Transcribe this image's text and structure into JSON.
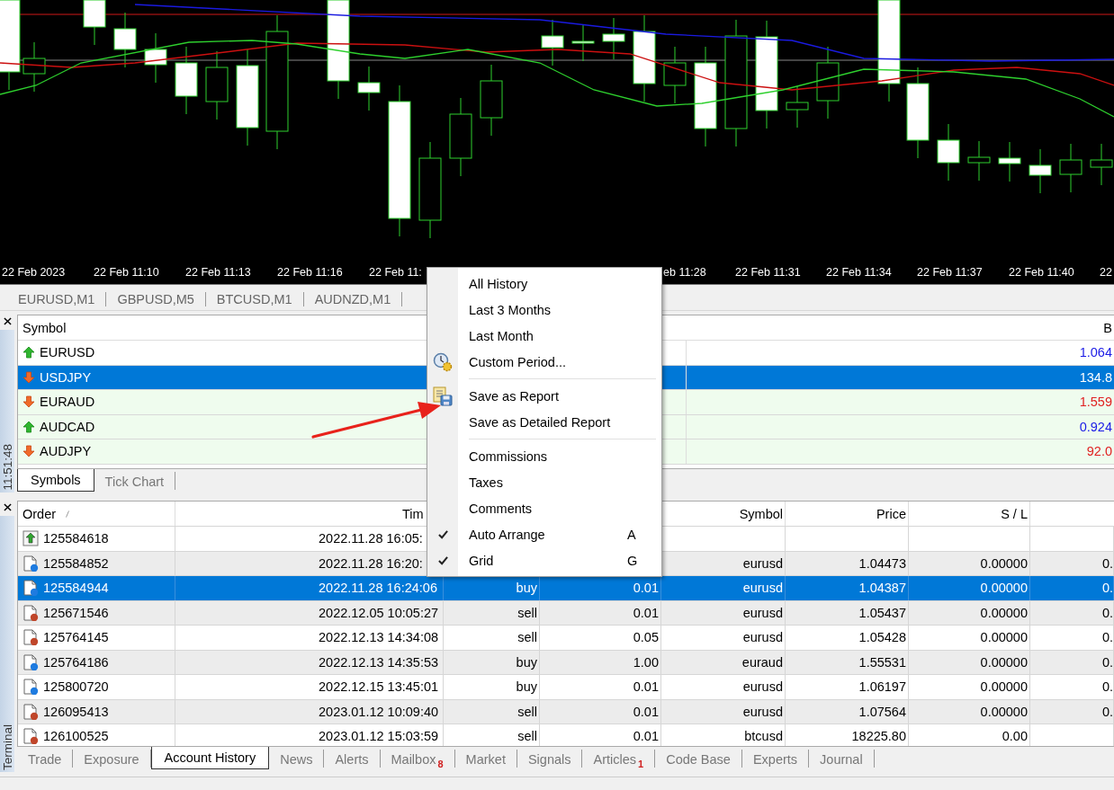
{
  "chart": {
    "time_axis": [
      "22 Feb 2023",
      "22 Feb 11:10",
      "22 Feb 11:13",
      "22 Feb 11:16",
      "22 Feb 11:",
      "eb 11:28",
      "22 Feb 11:31",
      "22 Feb 11:34",
      "22 Feb 11:37",
      "22 Feb 11:40",
      "22"
    ]
  },
  "chart_tabs": [
    "EURUSD,M1",
    "GBPUSD,M5",
    "BTCUSD,M1",
    "AUDNZD,M1"
  ],
  "market_watch": {
    "clock": "11:51:48",
    "columns": [
      "Symbol",
      "B"
    ],
    "rows": [
      {
        "symbol": "EURUSD",
        "rising": true,
        "highlighted": false,
        "selected": false,
        "bid": "1.064"
      },
      {
        "symbol": "USDJPY",
        "rising": false,
        "highlighted": true,
        "selected": true,
        "bid": "134.8"
      },
      {
        "symbol": "EURAUD",
        "rising": false,
        "highlighted": true,
        "selected": false,
        "bid": "1.559"
      },
      {
        "symbol": "AUDCAD",
        "rising": true,
        "highlighted": true,
        "selected": false,
        "bid": "0.924"
      },
      {
        "symbol": "AUDJPY",
        "rising": false,
        "highlighted": true,
        "selected": false,
        "bid": "92.0"
      }
    ],
    "tabs": [
      {
        "label": "Symbols",
        "selected": true
      },
      {
        "label": "Tick Chart",
        "selected": false
      }
    ]
  },
  "terminal": {
    "label": "Terminal",
    "columns": [
      "Order",
      "Tim",
      "Symbol",
      "Price",
      "S / L"
    ],
    "rows": [
      {
        "kind": "deposit",
        "selected": false,
        "order": "125584618",
        "time": "2022.11.28 16:05:"
      },
      {
        "kind": "buy",
        "selected": false,
        "order": "125584852",
        "time": "2022.11.28 16:20:",
        "symbol": "eurusd",
        "price": "1.04473",
        "sl": "0.00000",
        "tp": "0."
      },
      {
        "kind": "buy",
        "selected": true,
        "order": "125584944",
        "time": "2022.11.28 16:24:06",
        "type": "buy",
        "volume": "0.01",
        "symbol": "eurusd",
        "price": "1.04387",
        "sl": "0.00000",
        "tp": "0."
      },
      {
        "kind": "sell",
        "selected": false,
        "order": "125671546",
        "time": "2022.12.05 10:05:27",
        "type": "sell",
        "volume": "0.01",
        "symbol": "eurusd",
        "price": "1.05437",
        "sl": "0.00000",
        "tp": "0."
      },
      {
        "kind": "sell",
        "selected": false,
        "order": "125764145",
        "time": "2022.12.13 14:34:08",
        "type": "sell",
        "volume": "0.05",
        "symbol": "eurusd",
        "price": "1.05428",
        "sl": "0.00000",
        "tp": "0."
      },
      {
        "kind": "buy",
        "selected": false,
        "order": "125764186",
        "time": "2022.12.13 14:35:53",
        "type": "buy",
        "volume": "1.00",
        "symbol": "euraud",
        "price": "1.55531",
        "sl": "0.00000",
        "tp": "0."
      },
      {
        "kind": "buy",
        "selected": false,
        "order": "125800720",
        "time": "2022.12.15 13:45:01",
        "type": "buy",
        "volume": "0.01",
        "symbol": "eurusd",
        "price": "1.06197",
        "sl": "0.00000",
        "tp": "0."
      },
      {
        "kind": "sell",
        "selected": false,
        "order": "126095413",
        "time": "2023.01.12 10:09:40",
        "type": "sell",
        "volume": "0.01",
        "symbol": "eurusd",
        "price": "1.07564",
        "sl": "0.00000",
        "tp": "0."
      },
      {
        "kind": "sell",
        "selected": false,
        "order": "126100525",
        "time": "2023.01.12 15:03:59",
        "type": "sell",
        "volume": "0.01",
        "symbol": "btcusd",
        "price": "18225.80",
        "sl": "0.00"
      }
    ],
    "tabs": [
      {
        "label": "Trade",
        "selected": false
      },
      {
        "label": "Exposure",
        "selected": false
      },
      {
        "label": "Account History",
        "selected": true
      },
      {
        "label": "News",
        "selected": false
      },
      {
        "label": "Alerts",
        "selected": false
      },
      {
        "label": "Mailbox",
        "selected": false,
        "badge": "8"
      },
      {
        "label": "Market",
        "selected": false
      },
      {
        "label": "Signals",
        "selected": false
      },
      {
        "label": "Articles",
        "selected": false,
        "badge": "1"
      },
      {
        "label": "Code Base",
        "selected": false
      },
      {
        "label": "Experts",
        "selected": false
      },
      {
        "label": "Journal",
        "selected": false
      }
    ]
  },
  "context_menu": {
    "groups": [
      [
        {
          "label": "All History",
          "kind": "item",
          "checked": false
        },
        {
          "label": "Last 3 Months",
          "kind": "item",
          "checked": false
        },
        {
          "label": "Last Month",
          "kind": "item",
          "checked": false
        },
        {
          "label": "Custom Period...",
          "kind": "period_dialog",
          "checked": false
        }
      ],
      [
        {
          "label": "Save as Report",
          "kind": "report_export",
          "checked": false
        },
        {
          "label": "Save as Detailed Report",
          "kind": "item",
          "checked": false
        }
      ],
      [
        {
          "label": "Commissions",
          "kind": "item",
          "checked": false
        },
        {
          "label": "Taxes",
          "kind": "item",
          "checked": false
        },
        {
          "label": "Comments",
          "kind": "item",
          "checked": false
        },
        {
          "label": "Auto Arrange",
          "kind": "item",
          "checked": true,
          "shortcut": "A"
        },
        {
          "label": "Grid",
          "kind": "item",
          "checked": true,
          "shortcut": "G"
        }
      ]
    ]
  }
}
